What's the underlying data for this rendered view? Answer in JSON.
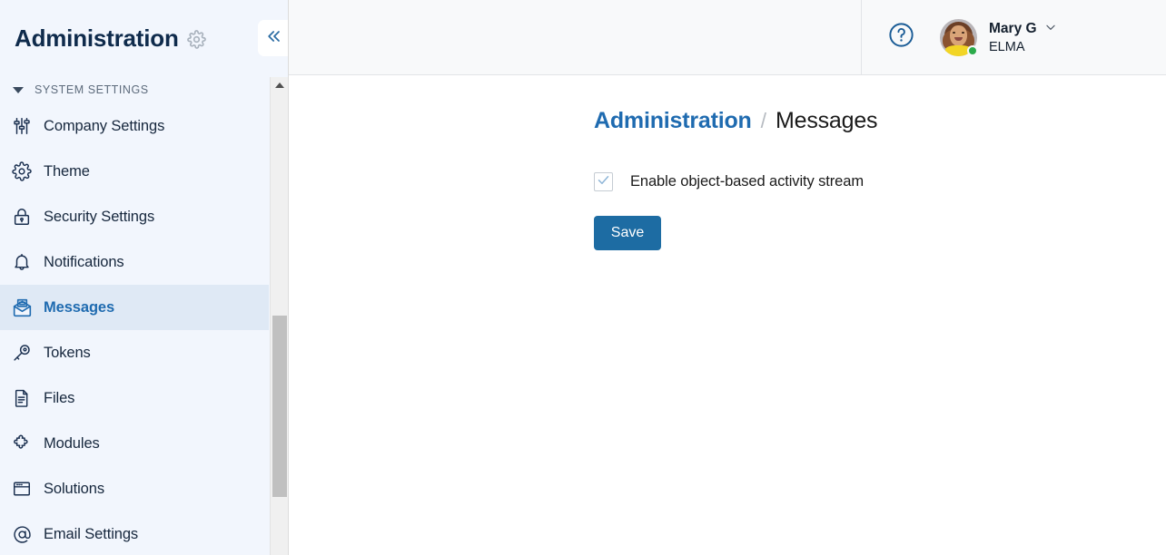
{
  "sidebar": {
    "title": "Administration",
    "title_gear_icon": "gear-icon",
    "collapse_icon": "double-chevron-left-icon",
    "group": {
      "label": "SYSTEM SETTINGS",
      "caret_icon": "caret-down-icon"
    },
    "items": [
      {
        "label": "Company Settings",
        "icon": "sliders-icon",
        "active": false
      },
      {
        "label": "Theme",
        "icon": "gear-icon",
        "active": false
      },
      {
        "label": "Security Settings",
        "icon": "lock-icon",
        "active": false
      },
      {
        "label": "Notifications",
        "icon": "bell-icon",
        "active": false
      },
      {
        "label": "Messages",
        "icon": "envelope-icon",
        "active": true
      },
      {
        "label": "Tokens",
        "icon": "key-icon",
        "active": false
      },
      {
        "label": "Files",
        "icon": "document-icon",
        "active": false
      },
      {
        "label": "Modules",
        "icon": "puzzle-icon",
        "active": false
      },
      {
        "label": "Solutions",
        "icon": "window-icon",
        "active": false
      },
      {
        "label": "Email Settings",
        "icon": "at-sign-icon",
        "active": false
      }
    ],
    "scrollbar": {
      "up_arrow_icon": "scroll-up-arrow-icon"
    }
  },
  "topbar": {
    "help_icon": "question-circle-icon",
    "user": {
      "name": "Mary G",
      "organization": "ELMA",
      "dropdown_icon": "chevron-down-icon",
      "status": "online",
      "avatar_icon": "user-avatar"
    }
  },
  "content": {
    "breadcrumb": {
      "parent": "Administration",
      "separator": "/",
      "current": "Messages"
    },
    "checkbox": {
      "label": "Enable object-based activity stream",
      "checked": true,
      "check_icon": "checkmark-icon"
    },
    "save_label": "Save"
  },
  "colors": {
    "sidebar_bg": "#f2f6fd",
    "sidebar_active_bg": "#dfe9f5",
    "accent_blue": "#1f6bb0",
    "button_blue": "#1d6ca3",
    "topbar_bg": "#f8f9fa",
    "status_green": "#2bab4b",
    "title_navy": "#0f2b4c"
  }
}
